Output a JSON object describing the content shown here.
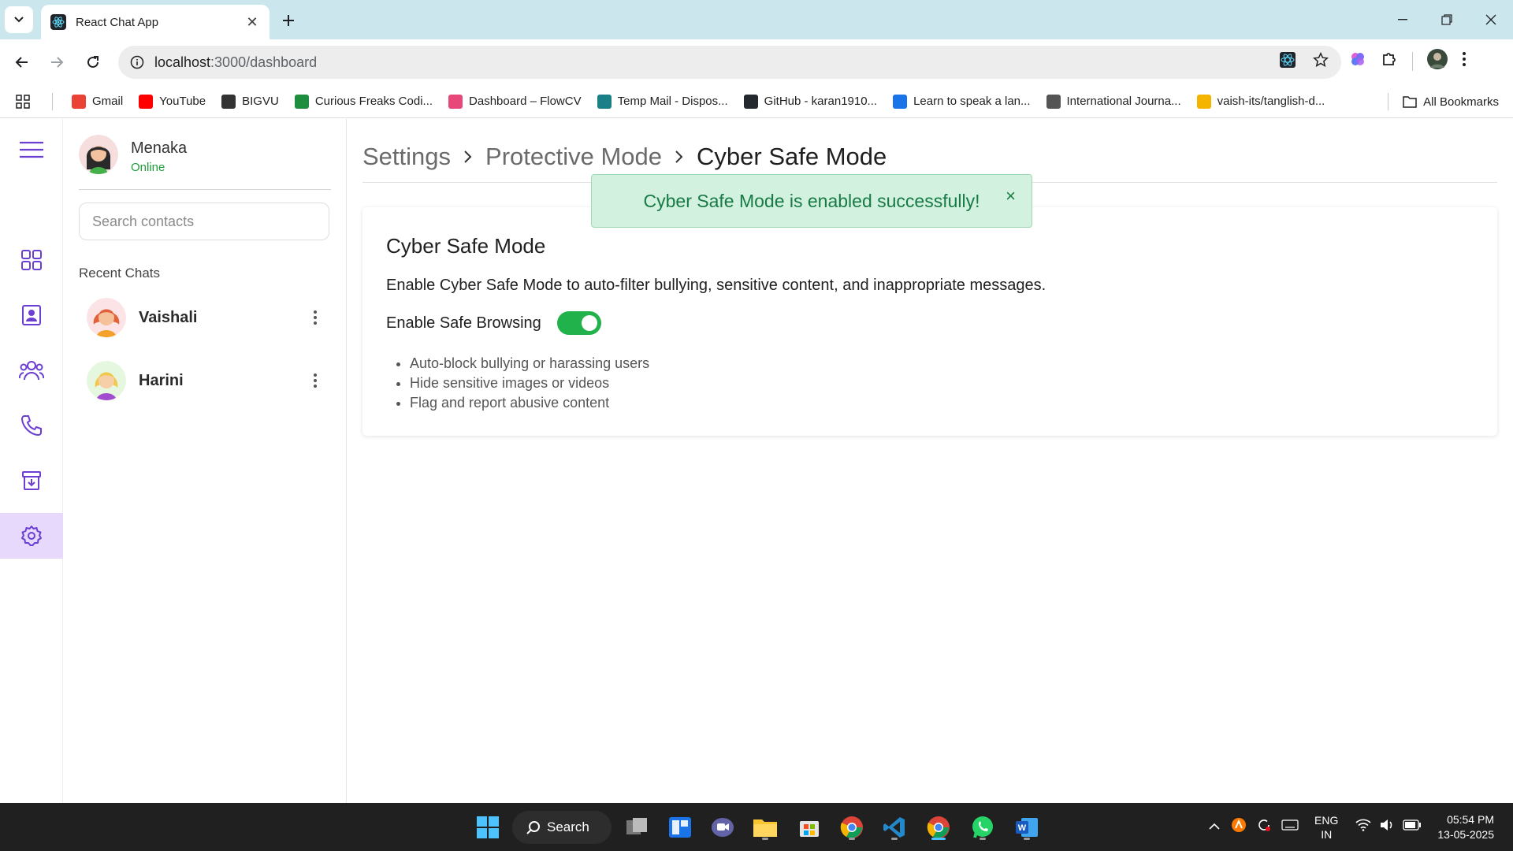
{
  "browser": {
    "tab_title": "React Chat App",
    "url_host": "localhost",
    "url_path": ":3000/dashboard",
    "bookmarks": [
      {
        "label": "Gmail",
        "color": "#ea4335"
      },
      {
        "label": "YouTube",
        "color": "#ff0000"
      },
      {
        "label": "BIGVU",
        "color": "#333333"
      },
      {
        "label": "Curious Freaks Codi...",
        "color": "#1e8e3e"
      },
      {
        "label": "Dashboard – FlowCV",
        "color": "#e8477a"
      },
      {
        "label": "Temp Mail - Dispos...",
        "color": "#1a7f86"
      },
      {
        "label": "GitHub - karan1910...",
        "color": "#24292f"
      },
      {
        "label": "Learn to speak a lan...",
        "color": "#1a73e8"
      },
      {
        "label": "International Journa...",
        "color": "#555555"
      },
      {
        "label": "vaish-its/tanglish-d...",
        "color": "#f4b400"
      }
    ],
    "all_bookmarks": "All Bookmarks"
  },
  "user": {
    "name": "Menaka",
    "status": "Online"
  },
  "sidebar": {
    "search_placeholder": "Search contacts",
    "recent_title": "Recent Chats",
    "chats": [
      {
        "name": "Vaishali"
      },
      {
        "name": "Harini"
      }
    ]
  },
  "breadcrumb": {
    "items": [
      "Settings",
      "Protective Mode",
      "Cyber Safe Mode"
    ]
  },
  "toast": {
    "message": "Cyber Safe Mode is enabled successfully!",
    "close": "×"
  },
  "card": {
    "title": "Cyber Safe Mode",
    "description": "Enable Cyber Safe Mode to auto-filter bullying, sensitive content, and inappropriate messages.",
    "toggle_label": "Enable Safe Browsing",
    "toggle_on": true,
    "features": [
      "Auto-block bullying or harassing users",
      "Hide sensitive images or videos",
      "Flag and report abusive content"
    ]
  },
  "taskbar": {
    "search_label": "Search",
    "lang_line1": "ENG",
    "lang_line2": "IN",
    "time": "05:54 PM",
    "date": "13-05-2025"
  },
  "colors": {
    "accent": "#6b3fd1",
    "rail_active_bg": "#e6d9fb",
    "toggle_on": "#22b24c",
    "toast_bg": "#d2f1df",
    "toast_text": "#177a45",
    "online": "#1e9e3a"
  }
}
